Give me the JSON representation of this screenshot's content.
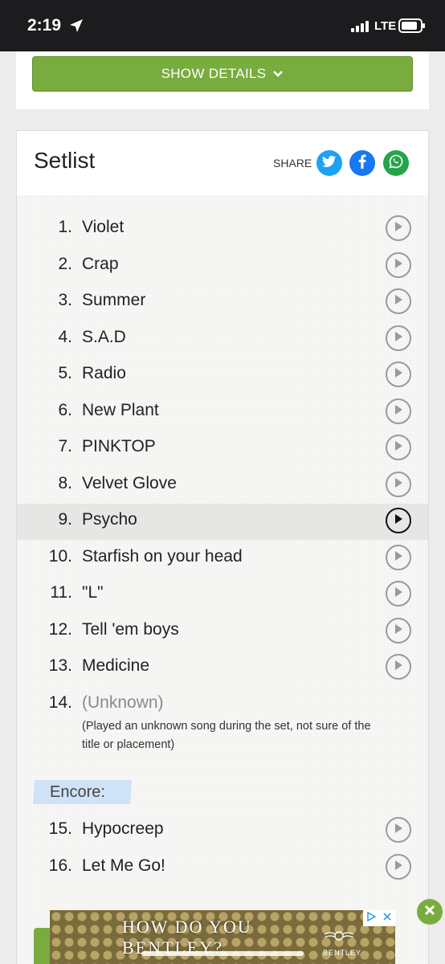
{
  "status_bar": {
    "time": "2:19",
    "network": "LTE"
  },
  "details": {
    "show_details_label": "SHOW DETAILS"
  },
  "setlist": {
    "title": "Setlist",
    "share_label": "SHARE",
    "songs": [
      {
        "num": "1.",
        "name": "Violet"
      },
      {
        "num": "2.",
        "name": "Crap"
      },
      {
        "num": "3.",
        "name": "Summer"
      },
      {
        "num": "4.",
        "name": "S.A.D"
      },
      {
        "num": "5.",
        "name": "Radio"
      },
      {
        "num": "6.",
        "name": "New Plant"
      },
      {
        "num": "7.",
        "name": "PINKTOP"
      },
      {
        "num": "8.",
        "name": "Velvet Glove"
      },
      {
        "num": "9.",
        "name": "Psycho"
      },
      {
        "num": "10.",
        "name": "Starfish on your head"
      },
      {
        "num": "11.",
        "name": "\"L\""
      },
      {
        "num": "12.",
        "name": "Tell 'em boys"
      },
      {
        "num": "13.",
        "name": "Medicine"
      },
      {
        "num": "14.",
        "name": "(Unknown)"
      }
    ],
    "unknown_note": "(Played an unknown song during the set, not sure of the title or placement)",
    "encore_label": "Encore:",
    "encore_songs": [
      {
        "num": "15.",
        "name": "Hypocreep"
      },
      {
        "num": "16.",
        "name": "Let Me Go!"
      }
    ]
  },
  "ad": {
    "headline": "HOW DO YOU BENTLEY?",
    "brand": "BENTLEY"
  },
  "colors": {
    "accent_green": "#79ac3f",
    "twitter": "#1da1f2",
    "facebook": "#1877f2",
    "whatsapp": "#25a54a",
    "encore_bg": "#cfe2f7"
  }
}
